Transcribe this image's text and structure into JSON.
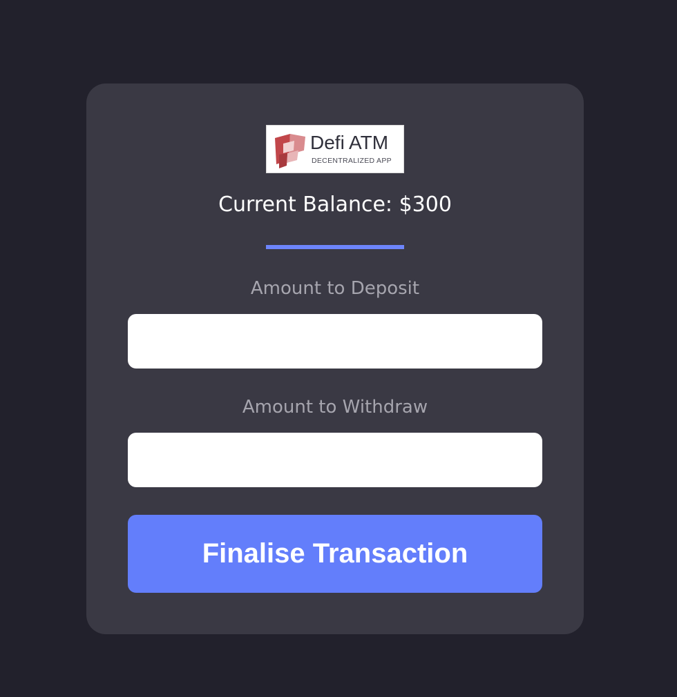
{
  "logo": {
    "title": "Defi ATM",
    "subtitle": "DECENTRALIZED APP",
    "icon": "defi-atm-logo-mark"
  },
  "balance": {
    "text": "Current Balance: $300"
  },
  "deposit": {
    "label": "Amount to Deposit",
    "value": "",
    "placeholder": ""
  },
  "withdraw": {
    "label": "Amount to Withdraw",
    "value": "",
    "placeholder": ""
  },
  "submit": {
    "label": "Finalise Transaction"
  },
  "colors": {
    "page_background": "#22212c",
    "card_background": "#3a3944",
    "accent": "#637efb",
    "label_text": "#a6a5ae",
    "logo_mark": "#c1464a"
  }
}
